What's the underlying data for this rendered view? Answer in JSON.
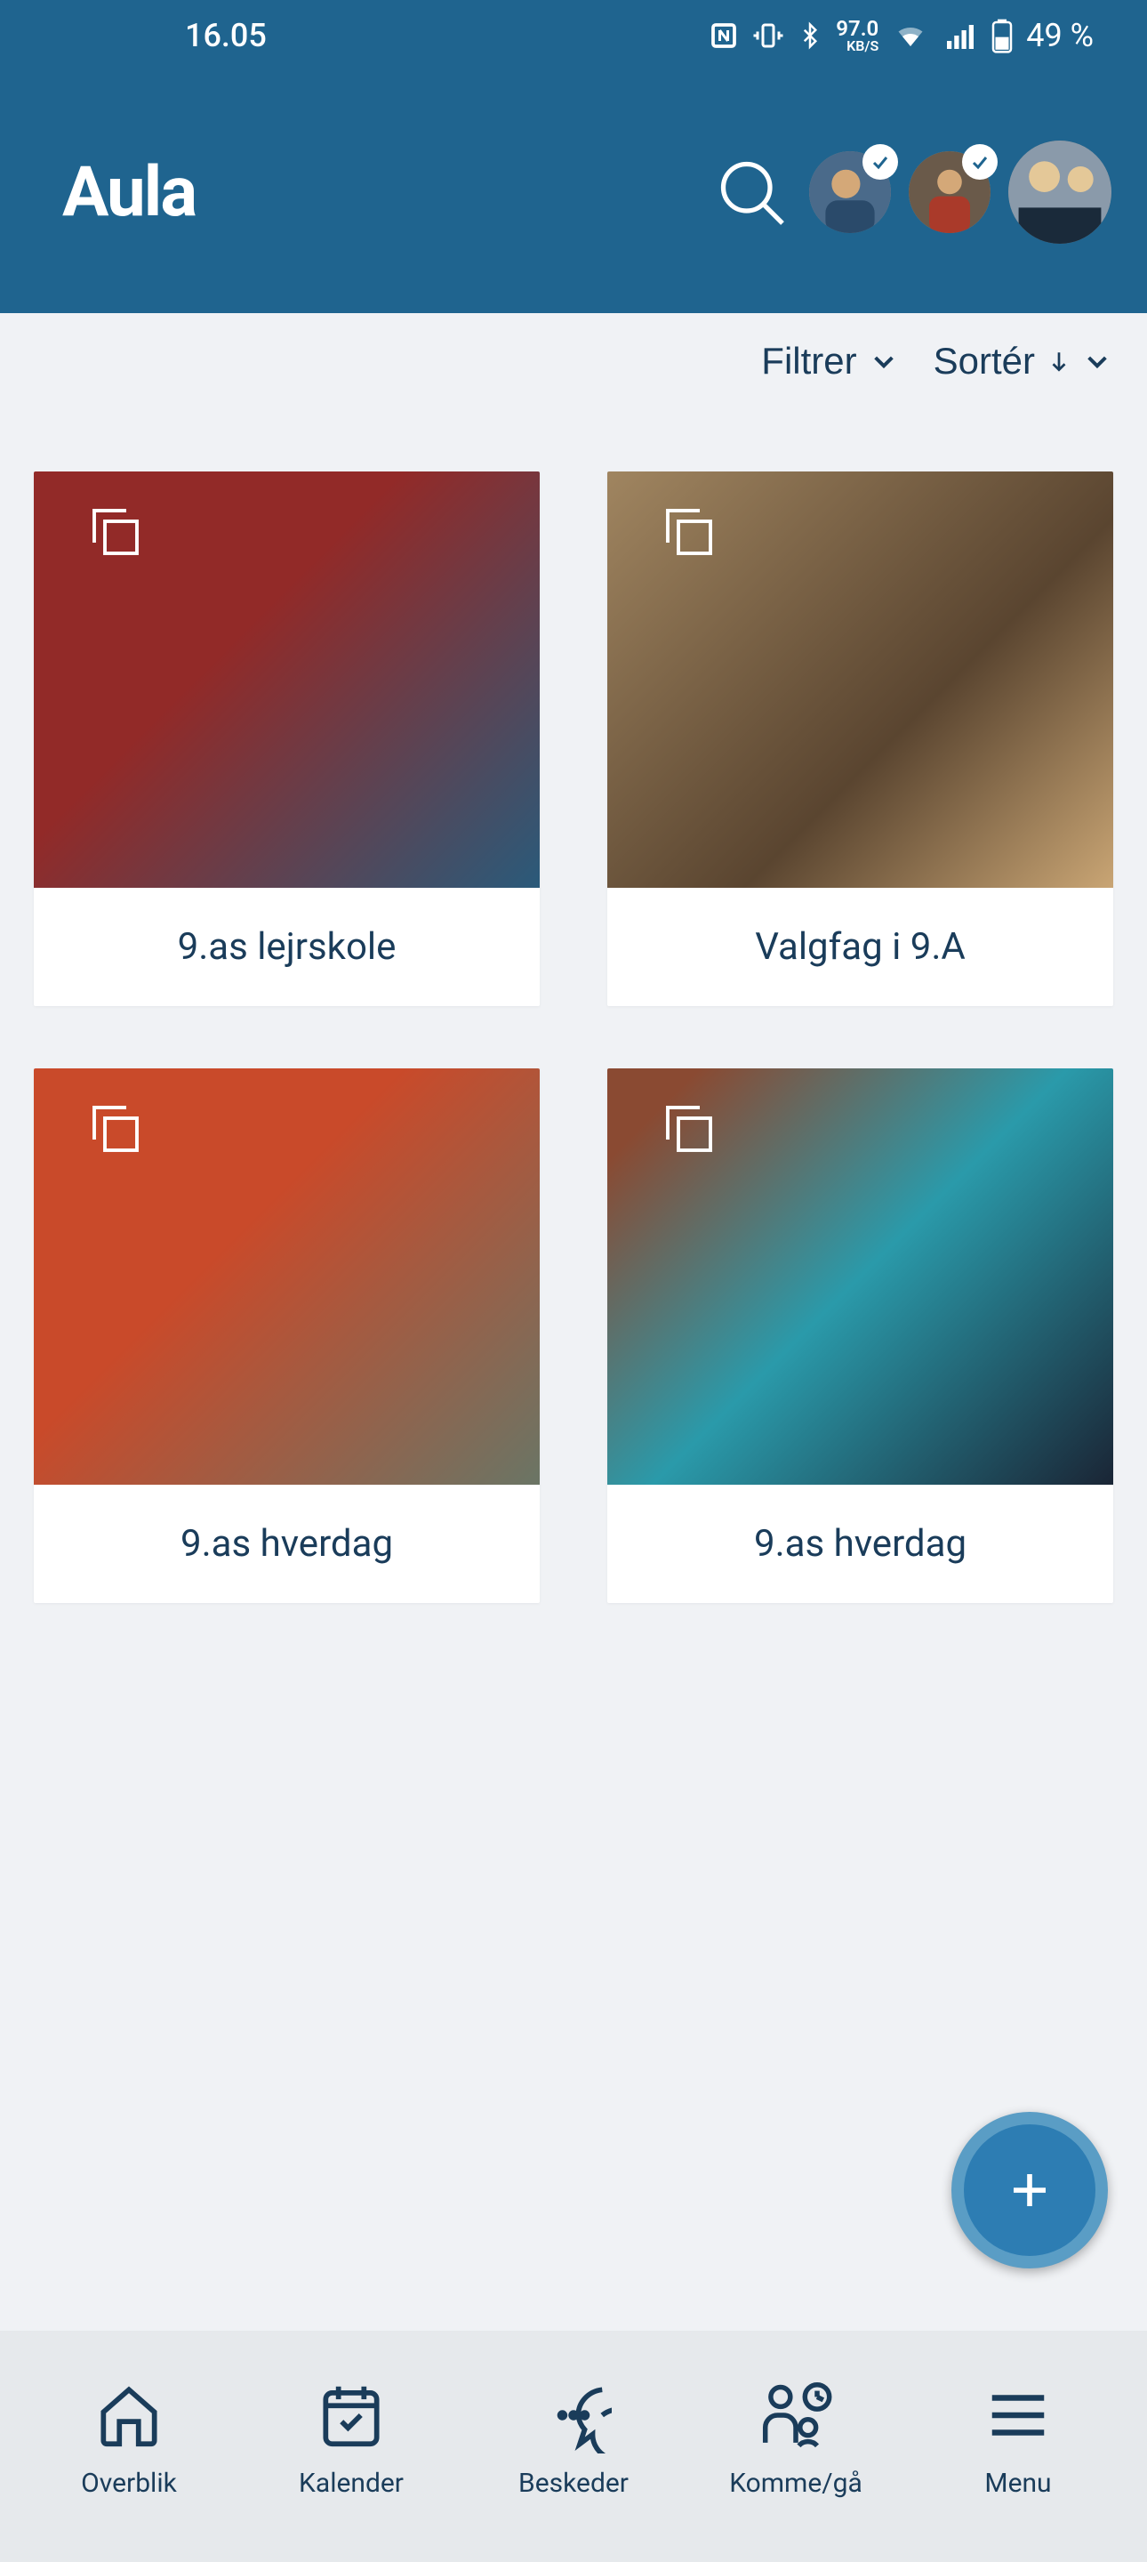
{
  "status": {
    "time": "16.05",
    "kbps": "97.0",
    "kbps_label": "KB/S",
    "battery": "49 %"
  },
  "header": {
    "logo": "Aula"
  },
  "filter_bar": {
    "filter_label": "Filtrer",
    "sort_label": "Sortér"
  },
  "albums": [
    {
      "title": "9.as lejrskole"
    },
    {
      "title": "Valgfag i 9.A"
    },
    {
      "title": "9.as hverdag"
    },
    {
      "title": "9.as hverdag"
    }
  ],
  "nav": {
    "overview": "Overblik",
    "calendar": "Kalender",
    "messages": "Beskeder",
    "come_go": "Komme/gå",
    "menu": "Menu"
  }
}
